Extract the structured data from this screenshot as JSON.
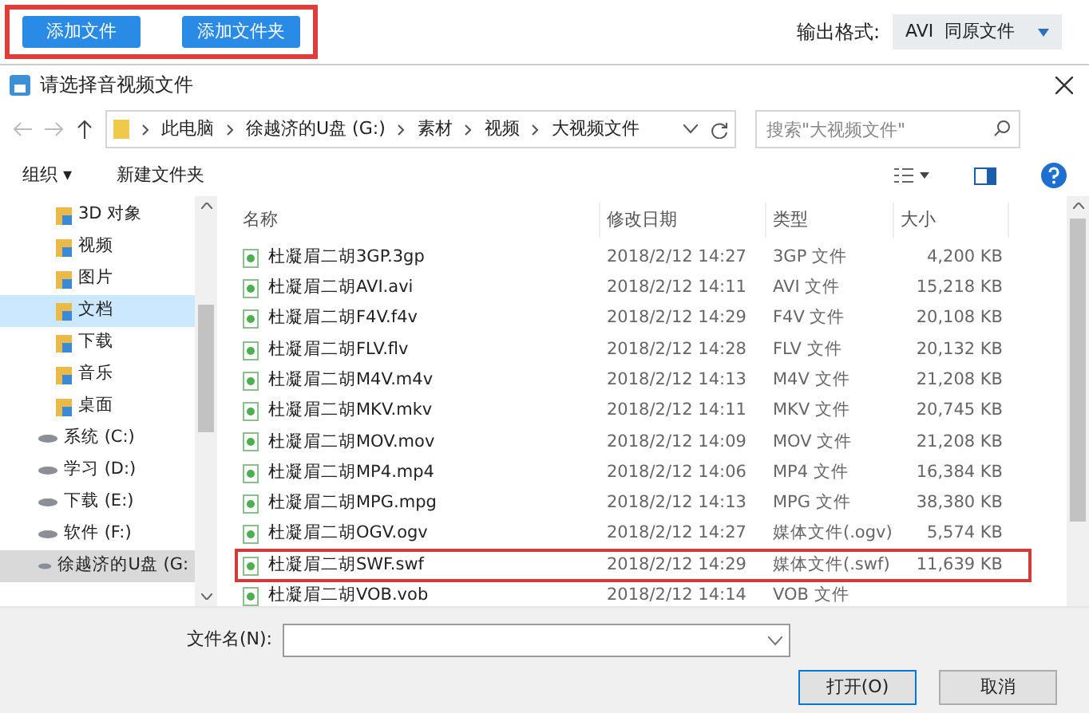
{
  "top_bar": {
    "buttons": [
      "添加文件",
      "添加文件夹"
    ],
    "format_label": "输出格式:",
    "format_value": "AVI  同原文件"
  },
  "dialog": {
    "title": "请选择音视频文件",
    "breadcrumb": [
      "此电脑",
      "徐越济的U盘 (G:)",
      "素材",
      "视频",
      "大视频文件"
    ],
    "search": {
      "placeholder": "搜索\"大视频文件\""
    },
    "toolbar": [
      "组织 ▾",
      "新建文件夹"
    ],
    "sidebar": [
      {
        "label": "3D 对象",
        "kind": "folder",
        "selected": false,
        "hovered": false
      },
      {
        "label": "视频",
        "kind": "folder",
        "selected": false,
        "hovered": false
      },
      {
        "label": "图片",
        "kind": "folder",
        "selected": false,
        "hovered": false
      },
      {
        "label": "文档",
        "kind": "folder",
        "selected": true,
        "hovered": false
      },
      {
        "label": "下载",
        "kind": "folder",
        "selected": false,
        "hovered": false
      },
      {
        "label": "音乐",
        "kind": "folder",
        "selected": false,
        "hovered": false
      },
      {
        "label": "桌面",
        "kind": "folder",
        "selected": false,
        "hovered": false
      },
      {
        "label": "系统 (C:)",
        "kind": "drive",
        "selected": false,
        "hovered": false
      },
      {
        "label": "学习 (D:)",
        "kind": "drive",
        "selected": false,
        "hovered": false
      },
      {
        "label": "下载 (E:)",
        "kind": "drive",
        "selected": false,
        "hovered": false
      },
      {
        "label": "软件 (F:)",
        "kind": "drive",
        "selected": false,
        "hovered": false
      },
      {
        "label": "徐越济的U盘 (G:",
        "kind": "drive",
        "selected": false,
        "hovered": true
      }
    ],
    "columns": [
      "名称",
      "修改日期",
      "类型",
      "大小"
    ],
    "rows": [
      {
        "name": "杜凝眉二胡3GP.3gp",
        "date": "2018/2/12 14:27",
        "type": "3GP 文件",
        "size": "4,200 KB",
        "highlighted": false
      },
      {
        "name": "杜凝眉二胡AVI.avi",
        "date": "2018/2/12 14:11",
        "type": "AVI 文件",
        "size": "15,218 KB",
        "highlighted": false
      },
      {
        "name": "杜凝眉二胡F4V.f4v",
        "date": "2018/2/12 14:29",
        "type": "F4V 文件",
        "size": "20,108 KB",
        "highlighted": false
      },
      {
        "name": "杜凝眉二胡FLV.flv",
        "date": "2018/2/12 14:28",
        "type": "FLV 文件",
        "size": "20,132 KB",
        "highlighted": false
      },
      {
        "name": "杜凝眉二胡M4V.m4v",
        "date": "2018/2/12 14:13",
        "type": "M4V 文件",
        "size": "21,208 KB",
        "highlighted": false
      },
      {
        "name": "杜凝眉二胡MKV.mkv",
        "date": "2018/2/12 14:11",
        "type": "MKV 文件",
        "size": "20,745 KB",
        "highlighted": false
      },
      {
        "name": "杜凝眉二胡MOV.mov",
        "date": "2018/2/12 14:09",
        "type": "MOV 文件",
        "size": "21,208 KB",
        "highlighted": false
      },
      {
        "name": "杜凝眉二胡MP4.mp4",
        "date": "2018/2/12 14:06",
        "type": "MP4 文件",
        "size": "16,384 KB",
        "highlighted": false
      },
      {
        "name": "杜凝眉二胡MPG.mpg",
        "date": "2018/2/12 14:13",
        "type": "MPG 文件",
        "size": "38,380 KB",
        "highlighted": false
      },
      {
        "name": "杜凝眉二胡OGV.ogv",
        "date": "2018/2/12 14:27",
        "type": "媒体文件(.ogv)",
        "size": "5,574 KB",
        "highlighted": false
      },
      {
        "name": "杜凝眉二胡SWF.swf",
        "date": "2018/2/12 14:29",
        "type": "媒体文件(.swf)",
        "size": "11,639 KB",
        "highlighted": true
      },
      {
        "name": "杜凝眉二胡VOB.vob",
        "date": "2018/2/12 14:14",
        "type": "VOB 文件",
        "highlighted": false
      }
    ],
    "filename_label": "文件名(N):",
    "buttons": [
      "打开(O)",
      "取消"
    ]
  }
}
